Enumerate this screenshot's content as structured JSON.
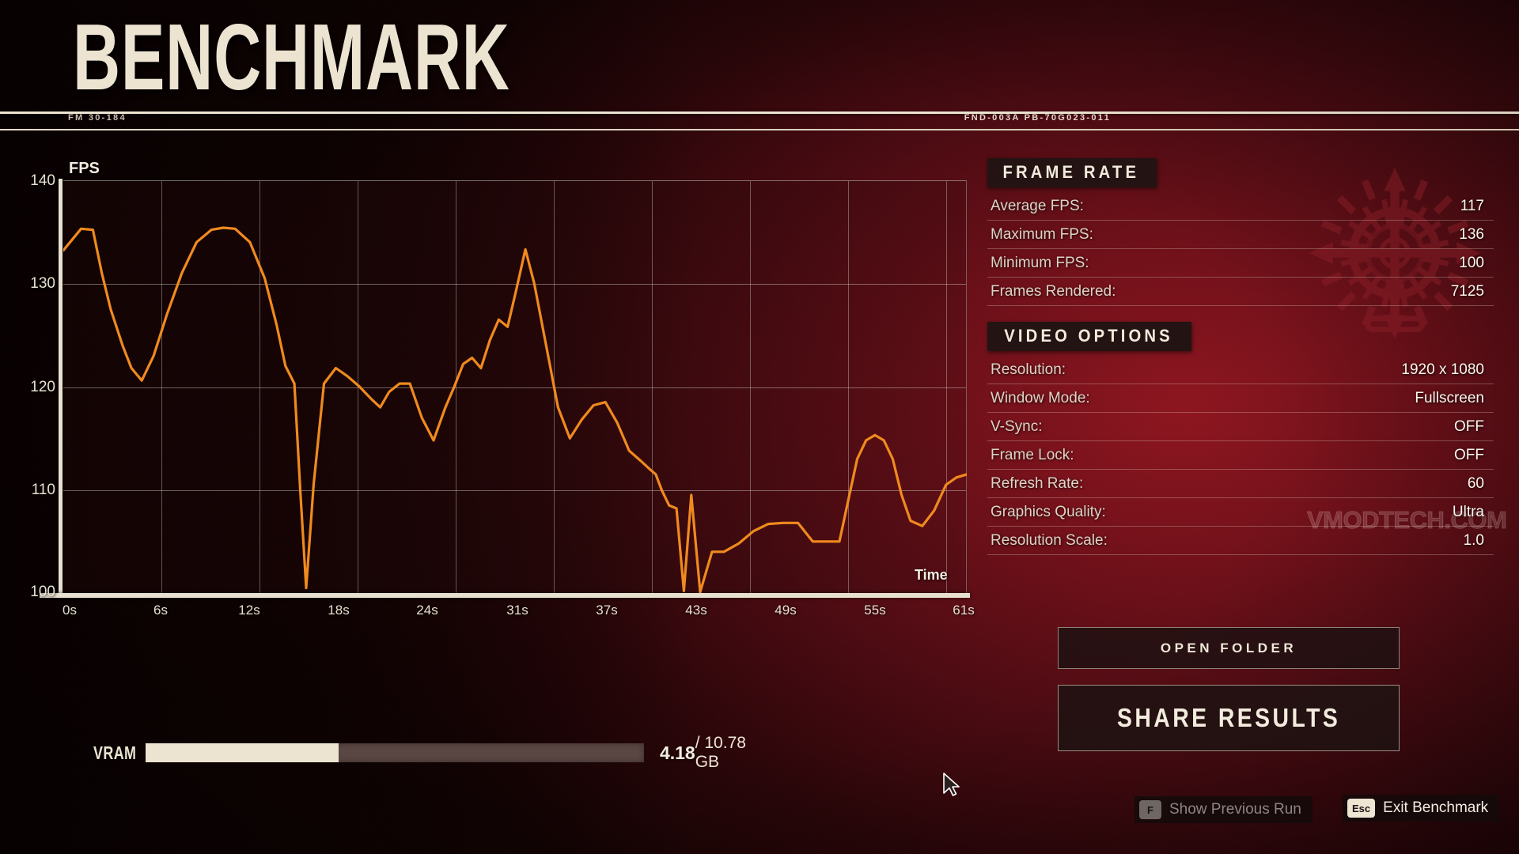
{
  "header": {
    "title": "BENCHMARK",
    "code_left": "FM 30-184",
    "code_right": "FND-003A PB-70G023-011"
  },
  "chart": {
    "unit_label": "FPS",
    "time_label": "Time"
  },
  "chart_data": {
    "type": "line",
    "title": "Benchmark frame rate over time",
    "xlabel": "Time",
    "ylabel": "FPS",
    "xlim": [
      0,
      61
    ],
    "ylim": [
      100,
      140
    ],
    "yticks": [
      100,
      110,
      120,
      130,
      140
    ],
    "xticks": [
      "0s",
      "6s",
      "12s",
      "18s",
      "24s",
      "31s",
      "37s",
      "43s",
      "49s",
      "55s",
      "61s"
    ],
    "grid": true,
    "legend": "none",
    "line_color": "#f08a1e",
    "series": [
      {
        "name": "FPS",
        "x": [
          0,
          1.2,
          2.0,
          2.6,
          3.2,
          4.0,
          4.6,
          5.3,
          6.1,
          7.0,
          8.0,
          9.0,
          10.0,
          10.8,
          11.6,
          12.6,
          13.6,
          14.4,
          15.0,
          15.6,
          16.0,
          16.4,
          16.9,
          17.6,
          18.4,
          19.2,
          20.0,
          20.8,
          21.4,
          22.0,
          22.7,
          23.4,
          24.2,
          25.0,
          25.8,
          26.4,
          27.0,
          27.6,
          28.2,
          28.8,
          29.4,
          30.0,
          30.6,
          31.2,
          31.8,
          32.6,
          33.4,
          34.2,
          35.0,
          35.8,
          36.6,
          37.4,
          38.2,
          39.0,
          39.6,
          40.0,
          40.4,
          40.9,
          41.4,
          41.9,
          42.4,
          43.0,
          43.8,
          44.6,
          45.6,
          46.6,
          47.6,
          48.6,
          49.6,
          50.6,
          51.2,
          51.8,
          52.4,
          53.0,
          53.6,
          54.2,
          54.8,
          55.4,
          56.0,
          56.6,
          57.2,
          58.0,
          58.8,
          59.6,
          60.3,
          61.0
        ],
        "y": [
          133.2,
          135.3,
          135.2,
          131.0,
          127.5,
          124.0,
          121.8,
          120.6,
          123.0,
          127.0,
          131.0,
          134.0,
          135.2,
          135.4,
          135.3,
          134.0,
          130.5,
          126.0,
          122.0,
          120.3,
          110.0,
          100.5,
          110.5,
          120.3,
          121.8,
          121.0,
          120.0,
          118.8,
          118.0,
          119.5,
          120.3,
          120.3,
          117.0,
          114.8,
          118.0,
          120.0,
          122.2,
          122.8,
          121.8,
          124.5,
          126.5,
          125.8,
          129.5,
          133.3,
          130.0,
          124.0,
          118.0,
          115.0,
          116.8,
          118.2,
          118.5,
          116.5,
          113.8,
          112.8,
          112.0,
          111.5,
          110.0,
          108.5,
          108.2,
          100.2,
          109.5,
          100.1,
          104.0,
          104.0,
          104.8,
          106.0,
          106.7,
          106.8,
          106.8,
          105.0,
          105.0,
          105.0,
          105.0,
          109.0,
          113.0,
          114.8,
          115.3,
          114.8,
          113.0,
          109.5,
          107.0,
          106.5,
          108.0,
          110.5,
          111.2,
          111.5
        ]
      }
    ]
  },
  "vram": {
    "label": "VRAM",
    "used": "4.18",
    "separator": " / ",
    "total": "10.78 GB",
    "percent": 38.8
  },
  "frame_rate": {
    "section_title": "FRAME RATE",
    "rows": [
      {
        "key": "Average FPS:",
        "value": "117"
      },
      {
        "key": "Maximum FPS:",
        "value": "136"
      },
      {
        "key": "Minimum FPS:",
        "value": "100"
      },
      {
        "key": "Frames Rendered:",
        "value": "7125"
      }
    ]
  },
  "video_options": {
    "section_title": "VIDEO OPTIONS",
    "rows": [
      {
        "key": "Resolution:",
        "value": "1920 x 1080"
      },
      {
        "key": "Window Mode:",
        "value": "Fullscreen"
      },
      {
        "key": "V-Sync:",
        "value": "OFF"
      },
      {
        "key": "Frame Lock:",
        "value": "OFF"
      },
      {
        "key": "Refresh Rate:",
        "value": "60"
      },
      {
        "key": "Graphics Quality:",
        "value": "Ultra"
      },
      {
        "key": "Resolution Scale:",
        "value": "1.0"
      }
    ]
  },
  "buttons": {
    "open_folder": "OPEN FOLDER",
    "share_results": "SHARE RESULTS"
  },
  "hints": {
    "previous_key": "F",
    "previous_label": "Show Previous Run",
    "exit_key": "Esc",
    "exit_label": "Exit Benchmark"
  },
  "watermark": "VMODTECH.COM",
  "colors": {
    "accent_line": "#f08a1e",
    "cream": "#ece3d1",
    "panel_header_bg": "#241313",
    "background_red": "#6d1019"
  }
}
